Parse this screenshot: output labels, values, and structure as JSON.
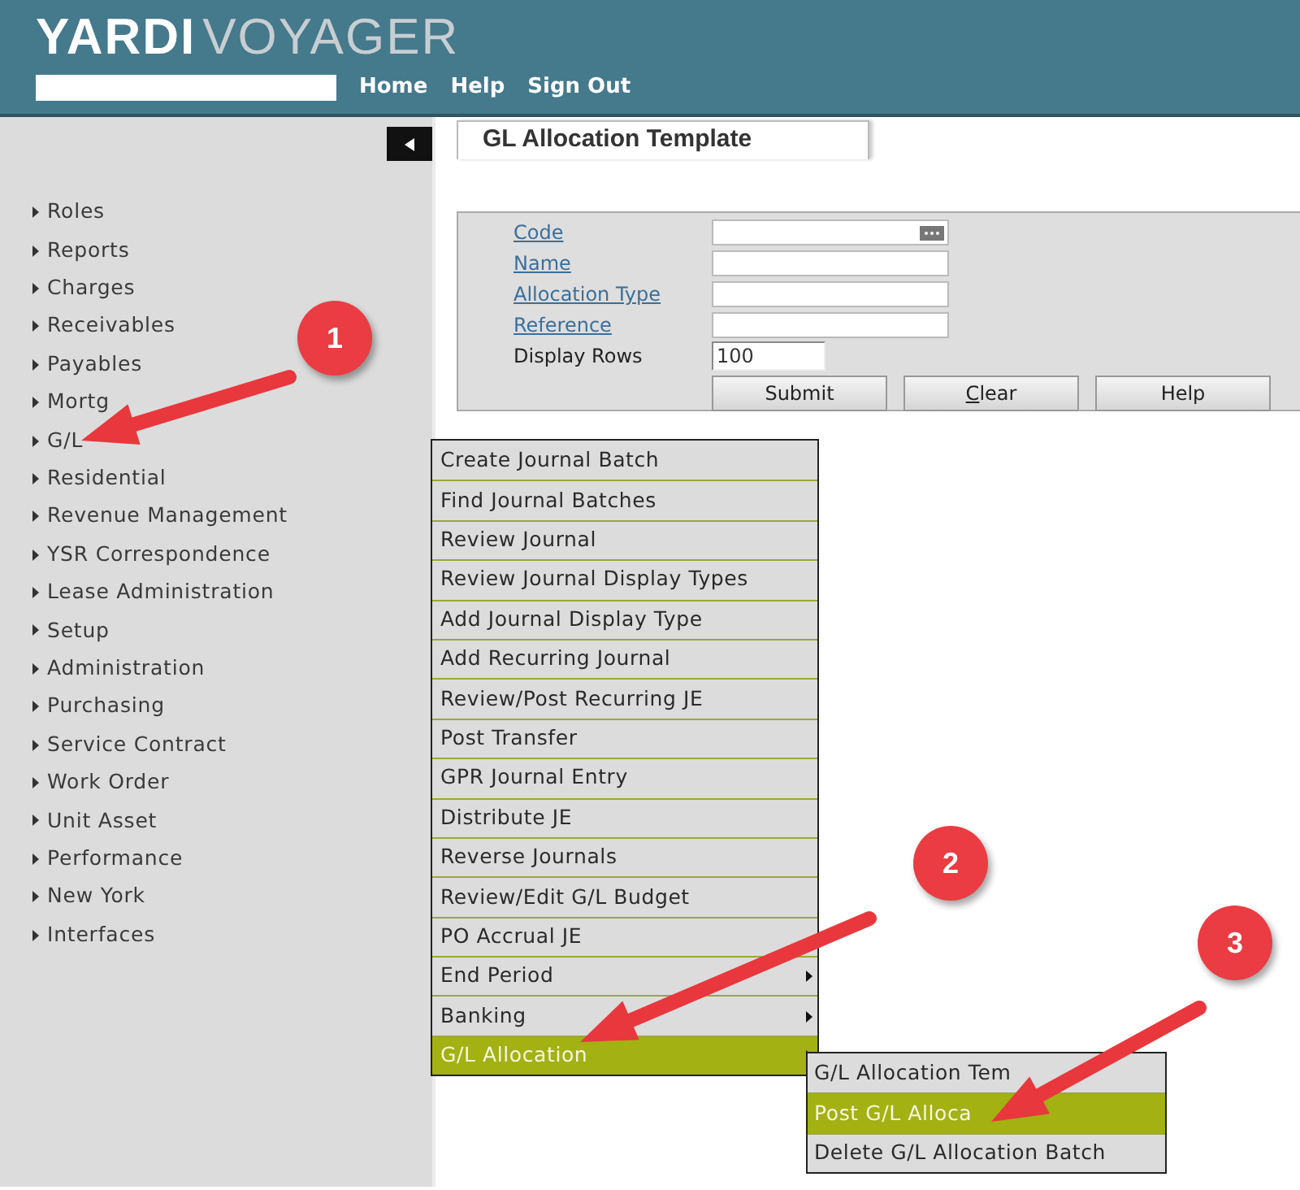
{
  "header": {
    "logo_bold": "YARDI",
    "logo_light": "VOYAGER",
    "nav_links": [
      "Home",
      "Help",
      "Sign Out"
    ]
  },
  "sidebar": {
    "items": [
      "Roles",
      "Reports",
      "Charges",
      "Receivables",
      "Payables",
      "Mortg",
      "G/L",
      "Residential",
      "Revenue Management",
      "YSR Correspondence",
      "Lease Administration",
      "Setup",
      "Administration",
      "Purchasing",
      "Service Contract",
      "Work Order",
      "Unit Asset",
      "Performance",
      "New York",
      "Interfaces"
    ]
  },
  "tab": {
    "label": "GL Allocation Template"
  },
  "form": {
    "fields": [
      {
        "label": "Code",
        "kind": "lookup"
      },
      {
        "label": "Name",
        "kind": "link"
      },
      {
        "label": "Allocation Type",
        "kind": "link"
      },
      {
        "label": "Reference",
        "kind": "link"
      },
      {
        "label": "Display Rows",
        "kind": "plain",
        "value": "100"
      }
    ],
    "buttons": [
      {
        "label": "Submit"
      },
      {
        "label": "lear",
        "access_key": "C"
      },
      {
        "label": "Help"
      }
    ]
  },
  "menu": {
    "items": [
      {
        "label": "Create Journal Batch",
        "selected": false,
        "submenu": false
      },
      {
        "label": "Find Journal Batches",
        "selected": false,
        "submenu": false
      },
      {
        "label": "Review Journal",
        "selected": false,
        "submenu": false
      },
      {
        "label": "Review Journal Display Types",
        "selected": false,
        "submenu": false
      },
      {
        "label": "Add Journal Display Type",
        "selected": false,
        "submenu": false
      },
      {
        "label": "Add Recurring Journal",
        "selected": false,
        "submenu": false
      },
      {
        "label": "Review/Post Recurring JE",
        "selected": false,
        "submenu": false
      },
      {
        "label": "Post Transfer",
        "selected": false,
        "submenu": false
      },
      {
        "label": "GPR Journal Entry",
        "selected": false,
        "submenu": false
      },
      {
        "label": "Distribute JE",
        "selected": false,
        "submenu": false
      },
      {
        "label": "Reverse Journals",
        "selected": false,
        "submenu": false
      },
      {
        "label": "Review/Edit G/L Budget",
        "selected": false,
        "submenu": false
      },
      {
        "label": "PO Accrual JE",
        "selected": false,
        "submenu": false
      },
      {
        "label": "End Period",
        "selected": false,
        "submenu": true
      },
      {
        "label": "Banking",
        "selected": false,
        "submenu": true
      },
      {
        "label": "G/L Allocation",
        "selected": true,
        "submenu": true
      }
    ]
  },
  "submenu": {
    "items": [
      {
        "label": "G/L Allocation Tem",
        "selected": false
      },
      {
        "label": "Post G/L Alloca",
        "selected": true
      },
      {
        "label": "Delete G/L Allocation Batch",
        "selected": false
      }
    ]
  },
  "callouts": [
    "1",
    "2",
    "3"
  ]
}
